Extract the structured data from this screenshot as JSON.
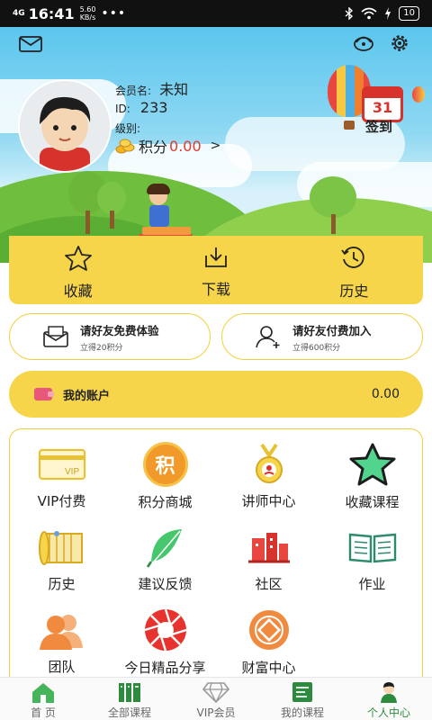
{
  "status_bar": {
    "signal": "4G",
    "time": "16:41",
    "speed_value": "5.60",
    "speed_unit": "KB/s",
    "more": "•••",
    "battery": "10"
  },
  "profile": {
    "member_label": "会员名:",
    "member_name": "未知",
    "id_label": "ID:",
    "id_value": "233",
    "level_label": "级别:",
    "points_label": "积分",
    "points_value": "0.00",
    "points_arrow": ">"
  },
  "checkin": {
    "day": "31",
    "label": "签到"
  },
  "actions": [
    {
      "label": "收藏",
      "icon": "star-outline-icon"
    },
    {
      "label": "下载",
      "icon": "download-tray-icon"
    },
    {
      "label": "历史",
      "icon": "history-clock-icon"
    }
  ],
  "invites": [
    {
      "title": "请好友免费体验",
      "subtitle": "立得20积分",
      "icon": "envelope-icon"
    },
    {
      "title": "请好友付费加入",
      "subtitle": "立得600积分",
      "icon": "add-user-icon"
    }
  ],
  "account": {
    "label": "我的账户",
    "value": "0.00"
  },
  "grid": [
    {
      "label": "VIP付费",
      "icon": "vip-card-icon"
    },
    {
      "label": "积分商城",
      "icon": "points-coin-icon",
      "icon_text": "积"
    },
    {
      "label": "讲师中心",
      "icon": "medal-icon"
    },
    {
      "label": "收藏课程",
      "icon": "star-filled-icon"
    },
    {
      "label": "历史",
      "icon": "scroll-icon"
    },
    {
      "label": "建议反馈",
      "icon": "feather-icon"
    },
    {
      "label": "社区",
      "icon": "buildings-icon"
    },
    {
      "label": "作业",
      "icon": "open-book-icon"
    },
    {
      "label": "团队",
      "icon": "team-icon"
    },
    {
      "label": "今日精品分享",
      "icon": "aperture-icon"
    },
    {
      "label": "财富中心",
      "icon": "fortune-coin-icon"
    }
  ],
  "bottom_nav": [
    {
      "label": "首 页",
      "icon": "home-icon"
    },
    {
      "label": "全部课程",
      "icon": "all-courses-icon"
    },
    {
      "label": "VIP会员",
      "icon": "diamond-icon"
    },
    {
      "label": "我的课程",
      "icon": "my-courses-icon"
    },
    {
      "label": "个人中心",
      "icon": "profile-icon",
      "active": true
    }
  ],
  "colors": {
    "accent_yellow": "#f6d54a",
    "points_red": "#e23b2e",
    "nav_active_green": "#2d8a3e"
  }
}
